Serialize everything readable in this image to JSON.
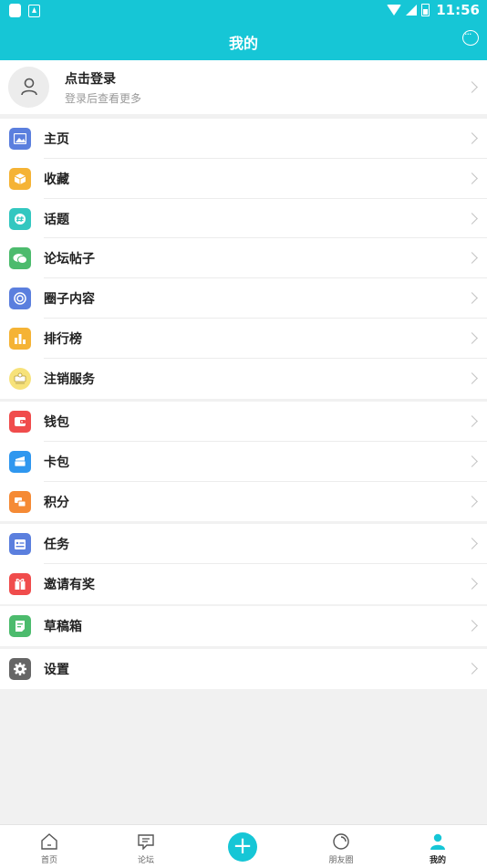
{
  "status_bar": {
    "time": "11:56"
  },
  "header": {
    "title": "我的",
    "message_icon": "chat-bubble-icon"
  },
  "login": {
    "title": "点击登录",
    "subtitle": "登录后查看更多",
    "avatar_icon": "person-icon"
  },
  "groups": [
    {
      "items": [
        {
          "label": "主页",
          "icon": "image-icon",
          "color": "#5b7fde"
        },
        {
          "label": "收藏",
          "icon": "box-icon",
          "color": "#f5b335"
        },
        {
          "label": "话题",
          "icon": "hashtag-icon",
          "color": "#33c7c0"
        },
        {
          "label": "论坛帖子",
          "icon": "chat-icon",
          "color": "#4cbb6d"
        },
        {
          "label": "圈子内容",
          "icon": "circle-icon",
          "color": "#5b7fde"
        },
        {
          "label": "排行榜",
          "icon": "bar-chart-icon",
          "color": "#f5b335"
        },
        {
          "label": "注销服务",
          "icon": "service-icon",
          "color": "#f7e27a"
        }
      ]
    },
    {
      "items": [
        {
          "label": "钱包",
          "icon": "wallet-icon",
          "color": "#f04c4c"
        },
        {
          "label": "卡包",
          "icon": "card-icon",
          "color": "#2f97ef"
        },
        {
          "label": "积分",
          "icon": "coins-icon",
          "color": "#f58a35"
        }
      ]
    },
    {
      "items": [
        {
          "label": "任务",
          "icon": "task-icon",
          "color": "#5b7fde"
        },
        {
          "label": "邀请有奖",
          "icon": "gift-icon",
          "color": "#f04c4c"
        }
      ]
    },
    {
      "items": [
        {
          "label": "草稿箱",
          "icon": "draft-icon",
          "color": "#4cbb6d"
        }
      ]
    },
    {
      "items": [
        {
          "label": "设置",
          "icon": "gear-icon",
          "color": "#666666"
        }
      ]
    }
  ],
  "tabbar": {
    "items": [
      {
        "label": "首页",
        "icon": "home-icon"
      },
      {
        "label": "论坛",
        "icon": "forum-icon"
      },
      {
        "label": "",
        "icon": "plus-icon"
      },
      {
        "label": "朋友圈",
        "icon": "moments-icon"
      },
      {
        "label": "我的",
        "icon": "profile-icon"
      }
    ],
    "accent": "#16c6d6"
  }
}
